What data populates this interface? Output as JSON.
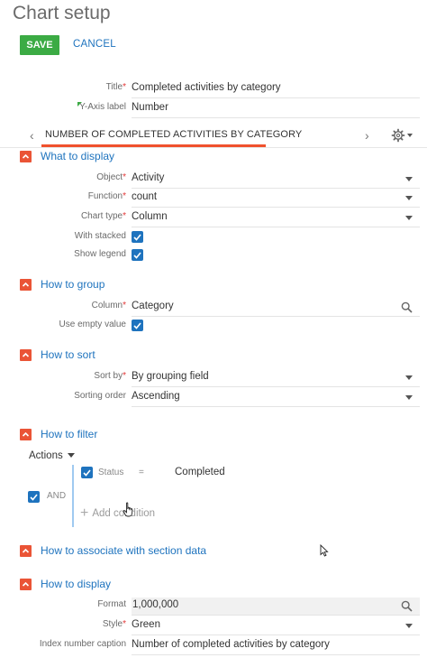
{
  "page": {
    "title": "Chart setup"
  },
  "toolbar": {
    "save_label": "SAVE",
    "cancel_label": "CANCEL"
  },
  "top_fields": {
    "title": {
      "label": "Title",
      "value": "Completed activities by category"
    },
    "yaxis": {
      "label": "Y-Axis label",
      "value": "Number"
    }
  },
  "tab": {
    "label": "NUMBER OF COMPLETED ACTIVITIES BY CATEGORY"
  },
  "what_to_display": {
    "title": "What to display",
    "object": {
      "label": "Object",
      "value": "Activity"
    },
    "function": {
      "label": "Function",
      "value": "count"
    },
    "chart_type": {
      "label": "Chart type",
      "value": "Column"
    },
    "with_stacked": {
      "label": "With stacked",
      "checked": true
    },
    "show_legend": {
      "label": "Show legend",
      "checked": true
    }
  },
  "how_to_group": {
    "title": "How to group",
    "column": {
      "label": "Column",
      "value": "Category"
    },
    "use_empty": {
      "label": "Use empty value",
      "checked": true
    }
  },
  "how_to_sort": {
    "title": "How to sort",
    "sort_by": {
      "label": "Sort by",
      "value": "By grouping field"
    },
    "sorting_order": {
      "label": "Sorting order",
      "value": "Ascending"
    }
  },
  "how_to_filter": {
    "title": "How to filter",
    "actions_label": "Actions",
    "group_operator": "AND",
    "condition": {
      "column": "Status",
      "operator": "=",
      "value": "Completed",
      "checked": true
    },
    "add_condition_label": "Add condition"
  },
  "associate": {
    "title": "How to associate with section data"
  },
  "how_to_display": {
    "title": "How to display",
    "format": {
      "label": "Format",
      "value": "1,000,000"
    },
    "style": {
      "label": "Style",
      "value": "Green"
    },
    "caption": {
      "label": "Index number caption",
      "value": "Number of completed activities by category"
    }
  },
  "colors": {
    "accent_blue": "#1e73be",
    "save_green": "#3bab44",
    "section_orange": "#ea5436",
    "tab_underline": "#f0512d"
  }
}
